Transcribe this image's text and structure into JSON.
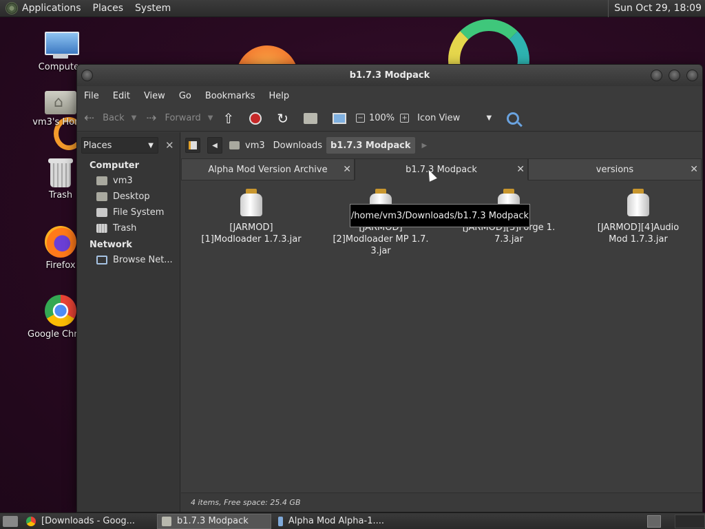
{
  "top_panel": {
    "menus": [
      "Applications",
      "Places",
      "System"
    ],
    "clock": "Sun Oct 29, 18:09"
  },
  "desktop_icons": [
    {
      "label": "Computer",
      "icon": "computer-icon"
    },
    {
      "label": "vm3's Home",
      "icon": "home-folder-icon"
    },
    {
      "label": "Trash",
      "icon": "trash-icon"
    },
    {
      "label": "Firefox",
      "icon": "firefox-icon"
    },
    {
      "label": "Google Chrome",
      "icon": "chrome-icon"
    }
  ],
  "window": {
    "title": "b1.7.3 Modpack",
    "menubar": [
      "File",
      "Edit",
      "View",
      "Go",
      "Bookmarks",
      "Help"
    ],
    "toolbar": {
      "back": "Back",
      "forward": "Forward",
      "zoom": "100%",
      "view_mode": "Icon View"
    },
    "sidebar": {
      "selector": "Places",
      "groups": [
        {
          "title": "Computer",
          "items": [
            "vm3",
            "Desktop",
            "File System",
            "Trash"
          ]
        },
        {
          "title": "Network",
          "items": [
            "Browse Net..."
          ]
        }
      ]
    },
    "pathbar": [
      "vm3",
      "Downloads",
      "b1.7.3 Modpack"
    ],
    "tabs": [
      {
        "label": "Alpha Mod Version Archive",
        "active": false
      },
      {
        "label": "b1.7.3 Modpack",
        "active": true
      },
      {
        "label": "versions",
        "active": false
      }
    ],
    "tooltip": "/home/vm3/Downloads/b1.7.3 Modpack",
    "files": [
      {
        "line1": "[JARMOD]",
        "line2": "[1]Modloader 1.7.3.jar",
        "line3": ""
      },
      {
        "line1": "[JARMOD]",
        "line2": "[2]Modloader MP 1.7.",
        "line3": "3.jar"
      },
      {
        "line1": "[JARMOD][3]Forge 1.",
        "line2": "7.3.jar",
        "line3": ""
      },
      {
        "line1": "[JARMOD][4]Audio",
        "line2": "Mod 1.7.3.jar",
        "line3": ""
      }
    ],
    "status": "4 items, Free space: 25.4 GB"
  },
  "taskbar": [
    {
      "label": "[Downloads - Goog...",
      "icon": "chrome",
      "active": false
    },
    {
      "label": "b1.7.3 Modpack",
      "icon": "folder",
      "active": true
    },
    {
      "label": "Alpha Mod Alpha-1....",
      "icon": "app",
      "active": false
    }
  ]
}
